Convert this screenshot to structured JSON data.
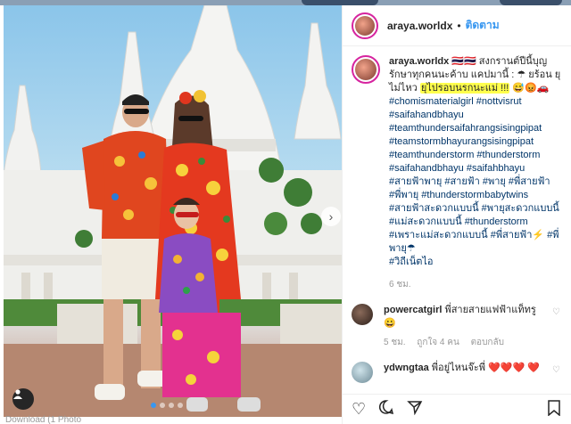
{
  "photo": {
    "watermark": "araya.worldx",
    "footer_text": "Download (1 Photo",
    "carousel_dots": 4,
    "active_dot": 0
  },
  "header": {
    "username": "araya.worldx",
    "separator": "•",
    "follow_label": "ติดตาม"
  },
  "caption": {
    "username": "araya.worldx",
    "text_pre": "🇹🇭🇹🇭 สงกรานต์ปีนี้บุญรักษาทุกคนนะค้าบ แคปมานี้ : ☂ ยร้อน ยุไม่ไหว",
    "text_highlight": "ยุไปรอบนรกนะแม่ !!!",
    "text_post": "😅😡🚗",
    "hashtags": [
      "#chomismaterialgirl #nottvisrut",
      "#saifahandbhayu",
      "#teamthundersaifahrangsisingpipat",
      "#teamstormbhayurangsisingpipat",
      "#teamthunderstorm #thunderstorm",
      "#saifahandbhayu #saifahbhayu",
      "#สายฟ้าพายุ #สายฟ้า #พายุ #พี่สายฟ้า",
      "#พี่พายุ #thunderstormbabytwins",
      "#สายฟ้าสะดวกแบบนี้ #พายุสะดวกแบบนี้",
      "#แม่สะดวกแบบนี้ #thunderstorm",
      "#เพราะแม่สะดวกแบบนี้ #พี่สายฟ้า⚡ #พี่",
      "พายุ☂",
      "#วิถีเน็ตไอ"
    ],
    "time": "6 ชม."
  },
  "comments": [
    {
      "username": "powercatgirl",
      "text": "พี่สายสายแฟฟ้าแท็ทรู 😀",
      "time": "5 ชม.",
      "likes": "ถูกใจ 4 คน",
      "reply": "ตอบกลับ",
      "avatar_color": "#4a3b35"
    },
    {
      "username": "ydwngtaa",
      "text": "พี่อยู่ไหนจ๊ะพี่ ❤️❤️❤️ ❤️",
      "avatar_color": "#a9c9d6"
    }
  ],
  "actions": {
    "like_icon": "heart-icon",
    "comment_icon": "comment-icon",
    "share_icon": "share-icon",
    "save_icon": "bookmark-icon"
  },
  "colors": {
    "link": "#3897f0",
    "hashtag": "#003569",
    "highlight": "#ffff4d"
  }
}
